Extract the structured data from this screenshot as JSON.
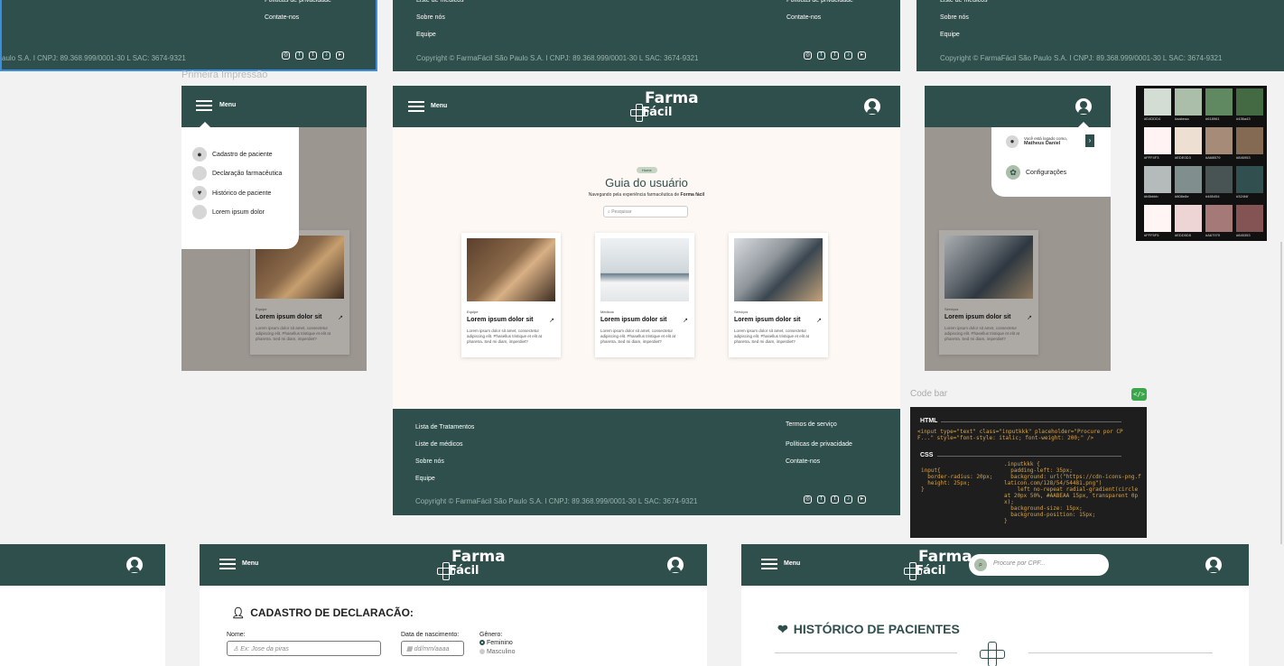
{
  "brand": {
    "line1": "Farma",
    "line2": "Fácil"
  },
  "footer": {
    "links_left": [
      "Lista de Tratamentos",
      "Liste de médicos",
      "Sobre nós",
      "Equipe"
    ],
    "links_right": [
      "Termos de serviço",
      "Políticas de privacidade",
      "Contate-nos"
    ],
    "copyright": "Copyright © FarmaFácil São Paulo S.A. I CNPJ: 89.368.999/0001-30 L SAC: 3674-9321",
    "copyright_cut": "aulo S.A. I CNPJ: 89.368.999/0001-30 L SAC: 3674-9321",
    "social": [
      "instagram-icon",
      "facebook-icon",
      "twitter-icon",
      "tiktok-icon",
      "youtube-icon"
    ]
  },
  "frame_label": "Primeira Impressão",
  "header": {
    "menu_label": "Menu"
  },
  "side_menu": {
    "items": [
      "Cadastro de paciente",
      "Declaração farmacêutica",
      "Histórico de paciente",
      "Lorem ipsum dolor"
    ]
  },
  "guide": {
    "badge": "Home",
    "title": "Guia do usuário",
    "subtitle_prefix": "Navegando pela experiência farmacêutica de ",
    "subtitle_brand": "Forma fácil",
    "search_placeholder": "Pesquisar"
  },
  "cards": [
    {
      "tag": "Equipe",
      "title": "Lorem ipsum dolor sit",
      "desc": "Lorem ipsum dolor sit amet, consectetur adipiscing elit. Phasellus tristique et elit at pharetra. Sed mi diam, imperdiet?"
    },
    {
      "tag": "Médicos",
      "title": "Lorem ipsum dolor sit",
      "desc": "Lorem ipsum dolor sit amet, consectetur adipiscing elit. Phasellus tristique et elit at pharetra. Sed mi diam, imperdiet?"
    },
    {
      "tag": "Serviços",
      "title": "Lorem ipsum dolor sit",
      "desc": "Lorem ipsum dolor sit amet, consectetur adipiscing elit. Phasellus tristique et elit at pharetra. Sed mi diam, imperdiet?"
    }
  ],
  "user_popup": {
    "logged_as": "Você está logado como,",
    "user": "Matheus Daniel",
    "settings": "Configurações"
  },
  "palette": {
    "rows": [
      [
        {
          "hex": "#d4ddd4",
          "label": "#D4DDD4"
        },
        {
          "hex": "#aabeaa",
          "label": "#aabeaa"
        },
        {
          "hex": "#618961",
          "label": "#618961"
        },
        {
          "hex": "#436a43",
          "label": "#436a43"
        }
      ],
      [
        {
          "hex": "#fff4f3",
          "label": "#FFF4F3"
        },
        {
          "hex": "#ede0d3",
          "label": "#EDE0D3"
        },
        {
          "hex": "#a68b79",
          "label": "#A68B79"
        },
        {
          "hex": "#846953",
          "label": "#846953"
        }
      ],
      [
        {
          "hex": "#b5bbbb",
          "label": "#b5bbbb"
        },
        {
          "hex": "#808e8e",
          "label": "#808e8e"
        },
        {
          "hex": "#485454",
          "label": "#485454"
        },
        {
          "hex": "#324f4f",
          "label": "#324f4f"
        }
      ],
      [
        {
          "hex": "#fff5f5",
          "label": "#FFF5F5"
        },
        {
          "hex": "#edd5d5",
          "label": "#EDD5D5"
        },
        {
          "hex": "#a67979",
          "label": "#A67979"
        },
        {
          "hex": "#845353",
          "label": "#845353"
        }
      ]
    ]
  },
  "code_bar": {
    "label": "Code bar",
    "html_heading": "HTML",
    "html_code": "<input type=\"text\" class=\"inputkkk\" placeholder=\"Procure por CPF...\" style=\"font-style: italic; font-weight: 200;\" />",
    "css_heading": "CSS",
    "css_left": "input{\n  border-radius: 20px;\n  height: 25px;\n}",
    "css_right": ".inputkkk {\n  padding-left: 35px;\n  background: url(\"https://cdn-icons-png.flaticon.com/128/54/54481.png\")\n    left no-repeat radial-gradient(circle at 20px 50%, #AABEAA 15px, transparent 0px);\n  background-size: 15px;\n  background-position: 15px;\n}"
  },
  "declaration": {
    "title": "CADASTRO DE DECLARACÃO:",
    "name_label": "Nome:",
    "name_placeholder": "Ex: Jose da piras",
    "dob_label": "Data de nascimento:",
    "dob_placeholder": "dd/mm/aaaa",
    "gender_label": "Gênero:",
    "gender_options": [
      "Feminino",
      "Masculino"
    ]
  },
  "history": {
    "title": "HISTÓRICO DE PACIENTES",
    "search_placeholder": "Procure por CPF..."
  }
}
